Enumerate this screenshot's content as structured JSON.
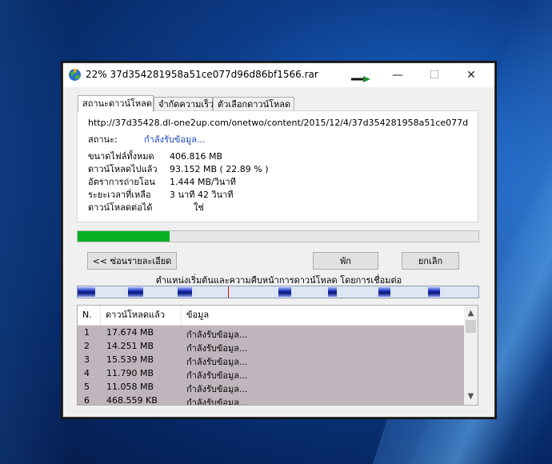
{
  "window": {
    "title": "22% 37d354281958a51ce077d96d86bf1566.rar",
    "controls": {
      "minimize": "—",
      "maximize": "☐",
      "close": "✕"
    }
  },
  "tabs": [
    {
      "label": "สถานะดาวน์โหลด",
      "active": true
    },
    {
      "label": "จำกัดความเร็ว",
      "active": false
    },
    {
      "label": "ตัวเลือกดาวน์โหลด",
      "active": false
    }
  ],
  "status_panel": {
    "url": "http://37d35428.dl-one2up.com/onetwo/content/2015/12/4/37d354281958a51ce077d96d86bf1566.rar",
    "status_label": "สถานะ:",
    "status_value": "กำลังรับข้อมูล...",
    "file_size_label": "ขนาดไฟล์ทั้งหมด",
    "file_size_value": "406.816  MB",
    "downloaded_label": "ดาวน์โหลดไปแล้ว",
    "downloaded_value": "93.152  MB  ( 22.89 % )",
    "transfer_rate_label": "อัตราการถ่ายโอน",
    "transfer_rate_value": "1.444  MB/วินาที",
    "time_left_label": "ระยะเวลาที่เหลือ",
    "time_left_value": "3 นาที 42 วินาที",
    "resume_label": "ดาวน์โหลดต่อได้",
    "resume_value": "ใช่"
  },
  "progress": {
    "fraction": 0.2289
  },
  "buttons": {
    "details": "<< ซ่อนรายละเอียด",
    "pause": "พัก",
    "cancel": "ยกเลิก"
  },
  "segments": {
    "caption": "ตำแหน่งเริ่มต้นและความคืบหน้าการดาวน์โหลด โดยการเชื่อมต่อ",
    "parts": [
      {
        "start": 0.0,
        "done": 0.043
      },
      {
        "start": 0.125,
        "done": 0.037
      },
      {
        "start": 0.25,
        "done": 0.035
      },
      {
        "start": 0.375,
        "done": 0.0
      },
      {
        "start": 0.5,
        "done": 0.032
      },
      {
        "start": 0.625,
        "done": 0.022
      },
      {
        "start": 0.75,
        "done": 0.03
      },
      {
        "start": 0.875,
        "done": 0.029
      }
    ]
  },
  "connections": {
    "headers": [
      "N.",
      "ดาวน์โหลดแล้ว",
      "ข้อมูล"
    ],
    "rows": [
      {
        "n": "1",
        "downloaded": "17.674  MB",
        "info": "กำลังรับข้อมูล..."
      },
      {
        "n": "2",
        "downloaded": "14.251  MB",
        "info": "กำลังรับข้อมูล..."
      },
      {
        "n": "3",
        "downloaded": "15.539  MB",
        "info": "กำลังรับข้อมูล..."
      },
      {
        "n": "4",
        "downloaded": "11.790  MB",
        "info": "กำลังรับข้อมูล..."
      },
      {
        "n": "5",
        "downloaded": "11.058  MB",
        "info": "กำลังรับข้อมูล..."
      },
      {
        "n": "6",
        "downloaded": "468.559  KB",
        "info": "กำลังรับข้อมูล..."
      }
    ]
  }
}
